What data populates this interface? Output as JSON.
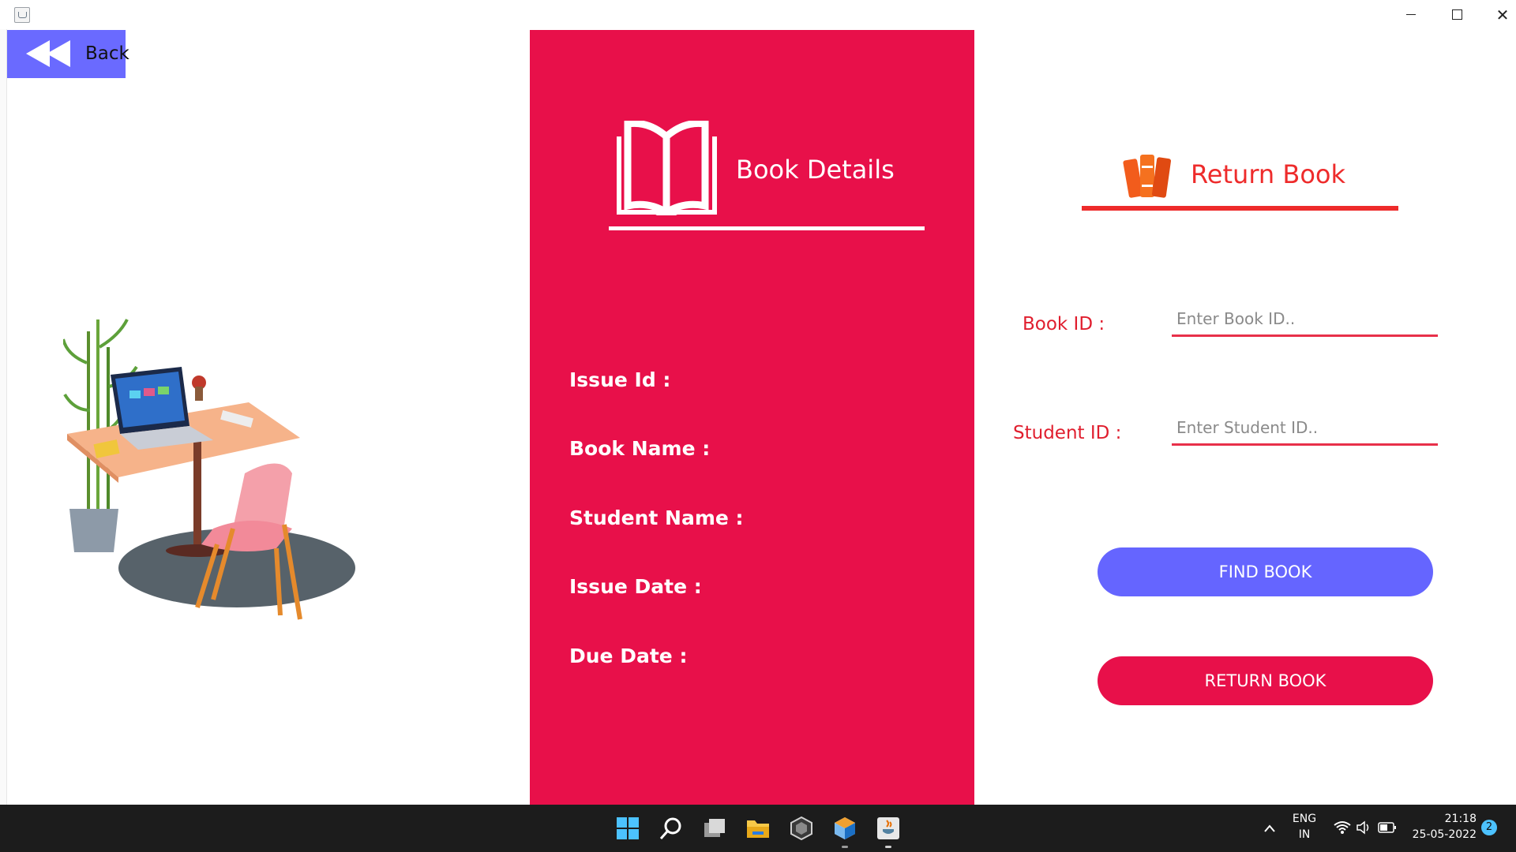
{
  "window": {
    "title": ""
  },
  "nav": {
    "back_label": "Back"
  },
  "details": {
    "title": "Book Details",
    "fields": [
      {
        "label": "Issue Id :"
      },
      {
        "label": "Book Name :"
      },
      {
        "label": "Student Name :"
      },
      {
        "label": "Issue Date :"
      },
      {
        "label": "Due Date :"
      }
    ]
  },
  "return_book": {
    "title": "Return Book",
    "book_id": {
      "label": "Book ID :",
      "placeholder": "Enter Book ID..",
      "value": ""
    },
    "student_id": {
      "label": "Student ID :",
      "placeholder": "Enter Student ID..",
      "value": ""
    },
    "find_button": "FIND BOOK",
    "return_button": "RETURN BOOK"
  },
  "colors": {
    "panel_red": "#e8104a",
    "accent_blue": "#6565ff",
    "heading_red": "#ee2b2b",
    "taskbar": "#1c1c1c"
  },
  "taskbar": {
    "icons": [
      "windows-start-icon",
      "search-icon",
      "task-view-icon",
      "file-explorer-icon",
      "unity-icon",
      "netbeans-icon",
      "java-icon"
    ],
    "language": "ENG",
    "region": "IN",
    "time": "21:18",
    "date": "25-05-2022",
    "notification_count": "2"
  }
}
